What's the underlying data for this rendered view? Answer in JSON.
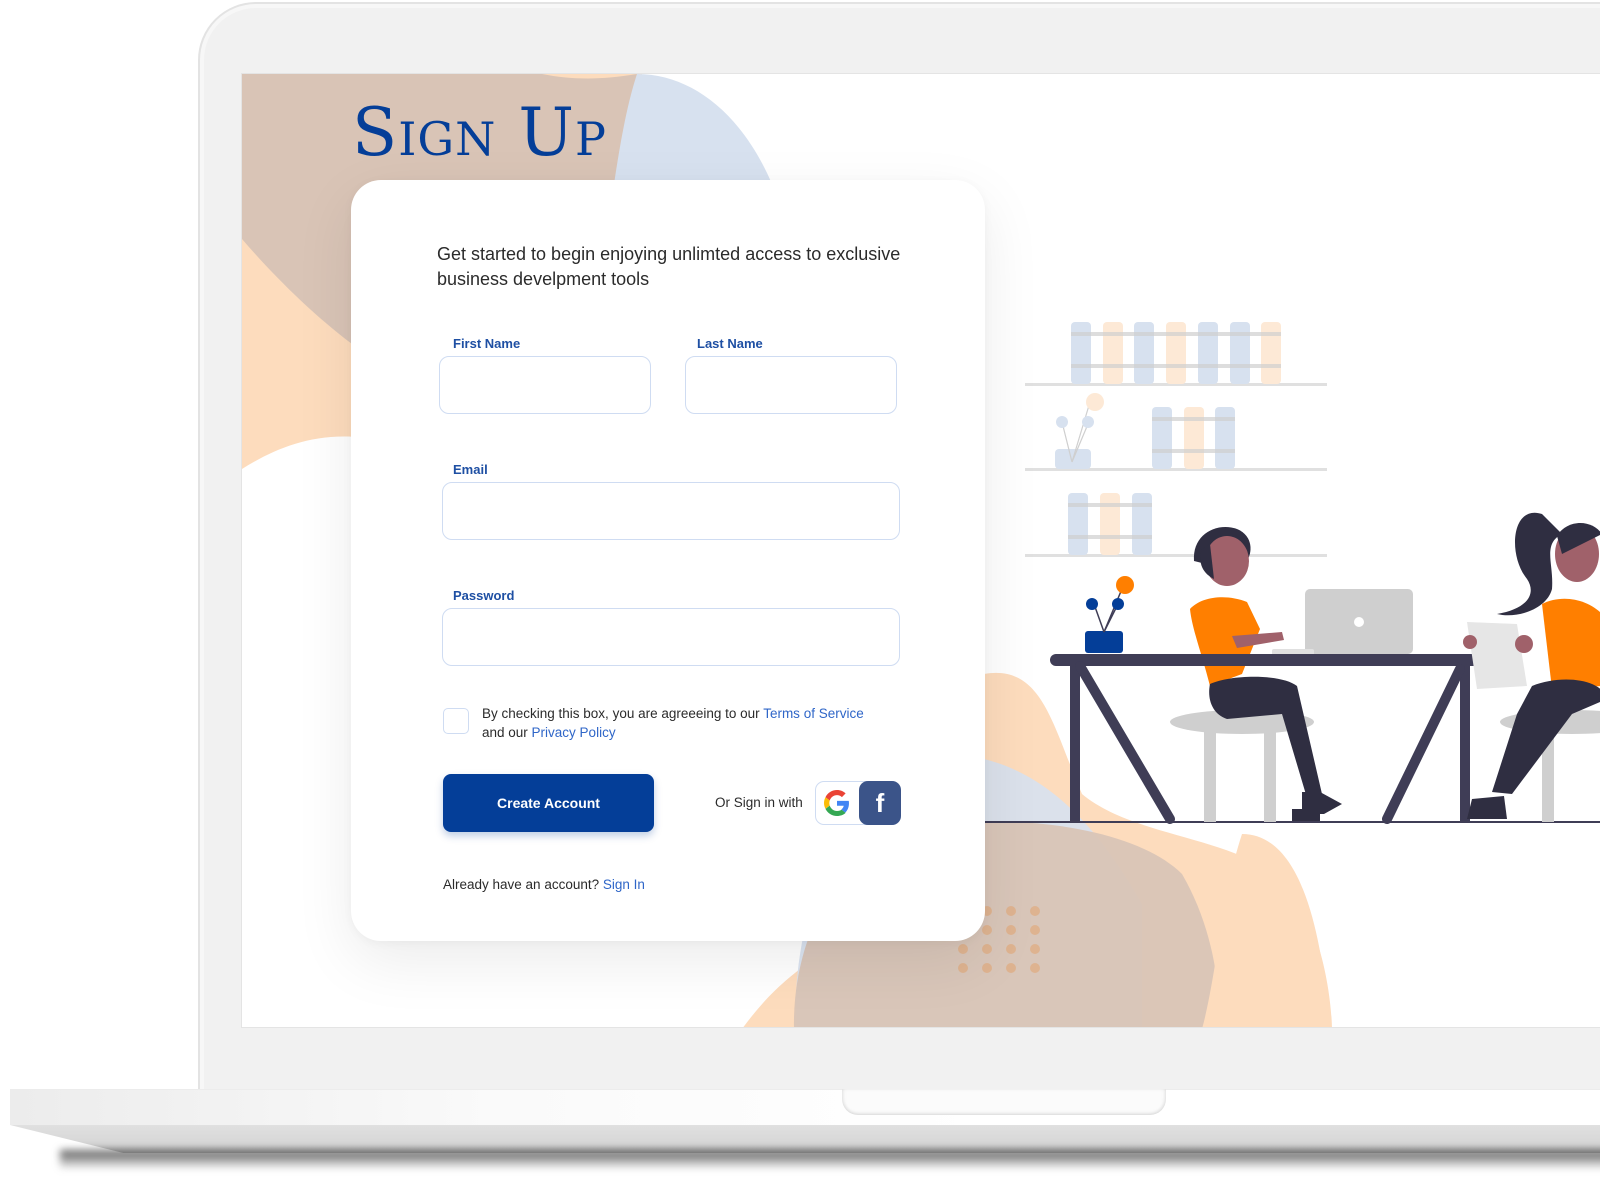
{
  "page": {
    "title": "Sign Up",
    "intro": "Get started to begin enjoying  unlimted access to exclusive business develpment tools"
  },
  "form": {
    "first_name": {
      "label": "First Name",
      "value": "",
      "placeholder": ""
    },
    "last_name": {
      "label": "Last Name",
      "value": "",
      "placeholder": ""
    },
    "email": {
      "label": "Email",
      "value": "",
      "placeholder": ""
    },
    "password": {
      "label": "Password",
      "value": "",
      "placeholder": ""
    },
    "consent": {
      "checked": false,
      "text_before": "By checking this box, you are agreeeing to our ",
      "terms_link": "Terms of Service",
      "text_middle": " and our ",
      "privacy_link": "Privacy Policy"
    },
    "create_button": "Create Account",
    "social_prompt": "Or Sign in with",
    "social": [
      {
        "name": "Google",
        "icon": "google-icon"
      },
      {
        "name": "Facebook",
        "icon": "facebook-icon",
        "glyph": "f"
      }
    ],
    "signin_prompt": "Already have an account? ",
    "signin_link": "Sign In"
  },
  "colors": {
    "brand_blue": "#043e98",
    "label_blue": "#1e4fa3",
    "link_blue": "#2f66c8",
    "facebook": "#3b5489",
    "blob_tan": "#d9c4b6",
    "blob_peach": "#fddcbd",
    "blob_blue": "#d7e1ef",
    "orange": "#ff7f00",
    "dark": "#3f3d56"
  }
}
